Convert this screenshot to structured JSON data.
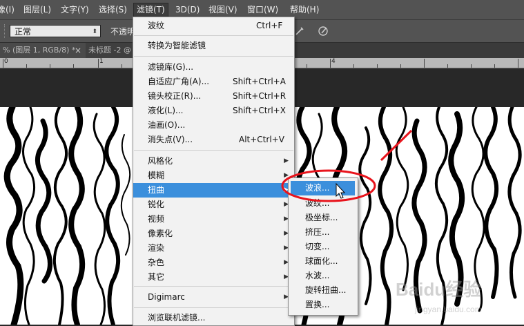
{
  "menubar": {
    "items": [
      "像(I)",
      "图层(L)",
      "文字(Y)",
      "选择(S)",
      "滤镜(T)",
      "3D(D)",
      "视图(V)",
      "窗口(W)",
      "帮助(H)"
    ],
    "active_index": 4
  },
  "options": {
    "mode_value": "正常",
    "opacity_label": "不透明"
  },
  "tabs": [
    {
      "label": "% (图层 1, RGB/8) *",
      "close": "×"
    },
    {
      "label": "未标题 -2 @"
    }
  ],
  "ruler": {
    "numbers": [
      "0",
      "1",
      "4"
    ]
  },
  "filter_menu": {
    "groups": [
      [
        {
          "label": "波纹",
          "shortcut": "Ctrl+F"
        }
      ],
      [
        {
          "label": "转换为智能滤镜"
        }
      ],
      [
        {
          "label": "滤镜库(G)..."
        },
        {
          "label": "自适应广角(A)...",
          "shortcut": "Shift+Ctrl+A"
        },
        {
          "label": "镜头校正(R)...",
          "shortcut": "Shift+Ctrl+R"
        },
        {
          "label": "液化(L)...",
          "shortcut": "Shift+Ctrl+X"
        },
        {
          "label": "油画(O)..."
        },
        {
          "label": "消失点(V)...",
          "shortcut": "Alt+Ctrl+V"
        }
      ],
      [
        {
          "label": "风格化",
          "submenu": true
        },
        {
          "label": "模糊",
          "submenu": true
        },
        {
          "label": "扭曲",
          "submenu": true,
          "highlighted": true
        },
        {
          "label": "锐化",
          "submenu": true
        },
        {
          "label": "视频",
          "submenu": true
        },
        {
          "label": "像素化",
          "submenu": true
        },
        {
          "label": "渲染",
          "submenu": true
        },
        {
          "label": "杂色",
          "submenu": true
        },
        {
          "label": "其它",
          "submenu": true
        }
      ],
      [
        {
          "label": "Digimarc",
          "submenu": true
        }
      ],
      [
        {
          "label": "浏览联机滤镜..."
        }
      ]
    ]
  },
  "distort_submenu": {
    "items": [
      "波浪...",
      "波纹...",
      "极坐标...",
      "挤压...",
      "切变...",
      "球面化...",
      "水波...",
      "旋转扭曲...",
      "置换..."
    ],
    "highlighted_index": 0
  },
  "watermark": {
    "text": "Baidu经验",
    "subtext": "jingyan.baidu.com"
  },
  "colors": {
    "highlight": "#3b8fdc",
    "annotation": "#e8141c",
    "menubar": "#535353"
  },
  "icons": [
    "submenu-arrow-icon",
    "mouse-cursor-icon",
    "airbrush-icon",
    "pressure-icon"
  ]
}
